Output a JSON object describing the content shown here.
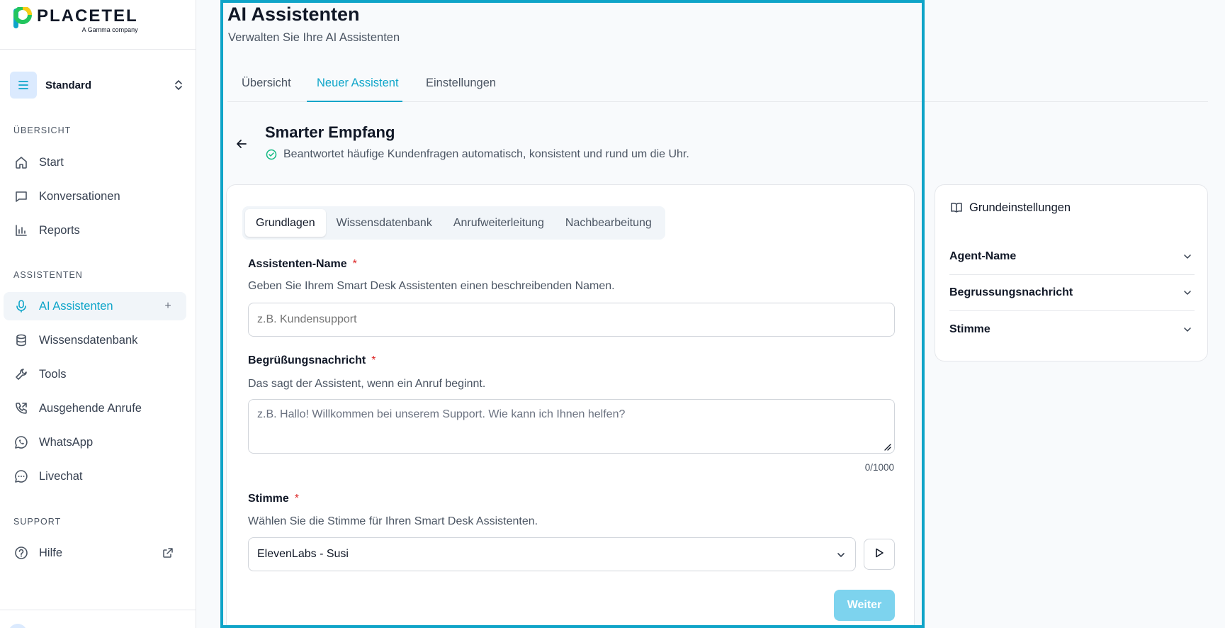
{
  "brand": {
    "name": "PLACETEL",
    "tagline": "A Gamma company"
  },
  "workspace": {
    "label": "Standard"
  },
  "sidebar": {
    "sections": [
      {
        "label": "ÜBERSICHT"
      },
      {
        "label": "ASSISTENTEN"
      },
      {
        "label": "SUPPORT"
      }
    ],
    "items": [
      {
        "label": "Start",
        "icon": "home-icon"
      },
      {
        "label": "Konversationen",
        "icon": "chat-icon"
      },
      {
        "label": "Reports",
        "icon": "bar-chart-icon"
      },
      {
        "label": "AI Assistenten",
        "icon": "microphone-icon",
        "active": true
      },
      {
        "label": "Wissensdatenbank",
        "icon": "database-icon"
      },
      {
        "label": "Tools",
        "icon": "wrench-icon"
      },
      {
        "label": "Ausgehende Anrufe",
        "icon": "phone-outgoing-icon"
      },
      {
        "label": "WhatsApp",
        "icon": "whatsapp-icon"
      },
      {
        "label": "Livechat",
        "icon": "livechat-icon"
      },
      {
        "label": "Hilfe",
        "icon": "help-icon"
      }
    ]
  },
  "header": {
    "title": "AI Assistenten",
    "subtitle": "Verwalten Sie Ihre AI Assistenten"
  },
  "tabs": [
    {
      "label": "Übersicht"
    },
    {
      "label": "Neuer Assistent",
      "active": true
    },
    {
      "label": "Einstellungen"
    }
  ],
  "section": {
    "title": "Smarter Empfang",
    "description": "Beantwortet häufige Kundenfragen automatisch, konsistent und rund um die Uhr."
  },
  "form": {
    "segments": [
      {
        "label": "Grundlagen",
        "active": true
      },
      {
        "label": "Wissensdatenbank"
      },
      {
        "label": "Anrufweiterleitung"
      },
      {
        "label": "Nachbearbeitung"
      }
    ],
    "name": {
      "label": "Assistenten-Name",
      "required": "*",
      "help": "Geben Sie Ihrem Smart Desk Assistenten einen beschreibenden Namen.",
      "placeholder": "z.B. Kundensupport"
    },
    "greeting": {
      "label": "Begrüßungsnachricht",
      "required": "*",
      "help": "Das sagt der Assistent, wenn ein Anruf beginnt.",
      "placeholder": "z.B. Hallo! Willkommen bei unserem Support. Wie kann ich Ihnen helfen?",
      "counter": "0/1000"
    },
    "voice": {
      "label": "Stimme",
      "required": "*",
      "help": "Wählen Sie die Stimme für Ihren Smart Desk Assistenten.",
      "value": "ElevenLabs - Susi"
    },
    "next_label": "Weiter"
  },
  "settings_panel": {
    "title": "Grundeinstellungen",
    "items": [
      {
        "label": "Agent-Name"
      },
      {
        "label": "Begrussungsnachricht"
      },
      {
        "label": "Stimme"
      }
    ]
  },
  "colors": {
    "accent": "#0ea5c9",
    "highlight": "#0fa4c8",
    "required": "#dc2626",
    "button_disabled": "#7dd3ee"
  }
}
